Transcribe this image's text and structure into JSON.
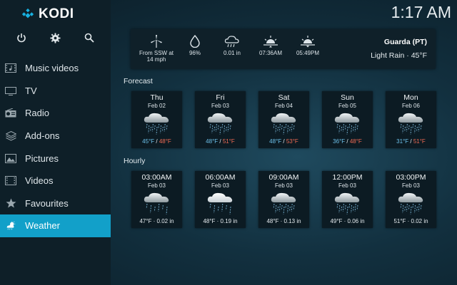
{
  "app": {
    "name": "KODI",
    "clock": "1:17 AM"
  },
  "sidebar": {
    "top_icons": [
      "power-icon",
      "settings-icon",
      "search-icon"
    ],
    "items": [
      {
        "label": "Music videos",
        "icon": "music-video-icon"
      },
      {
        "label": "TV",
        "icon": "tv-icon"
      },
      {
        "label": "Radio",
        "icon": "radio-icon"
      },
      {
        "label": "Add-ons",
        "icon": "addons-icon"
      },
      {
        "label": "Pictures",
        "icon": "pictures-icon"
      },
      {
        "label": "Videos",
        "icon": "videos-icon"
      },
      {
        "label": "Favourites",
        "icon": "star-icon"
      },
      {
        "label": "Weather",
        "icon": "weather-icon",
        "active": true
      }
    ]
  },
  "current": {
    "wind_line1": "From SSW at",
    "wind_line2": "14 mph",
    "humidity": "96%",
    "precip": "0.01 in",
    "sunrise": "07:36AM",
    "sunset": "05:49PM",
    "location": "Guarda (PT)",
    "condition": "Light Rain · 45°F"
  },
  "forecast": {
    "label": "Forecast",
    "days": [
      {
        "day": "Thu",
        "date": "Feb 02",
        "low": "45°F",
        "high": "48°F",
        "icon": "rain-cloud-icon"
      },
      {
        "day": "Fri",
        "date": "Feb 03",
        "low": "48°F",
        "high": "51°F",
        "icon": "rain-cloud-icon"
      },
      {
        "day": "Sat",
        "date": "Feb 04",
        "low": "48°F",
        "high": "53°F",
        "icon": "rain-cloud-icon"
      },
      {
        "day": "Sun",
        "date": "Feb 05",
        "low": "36°F",
        "high": "48°F",
        "icon": "rain-cloud-icon"
      },
      {
        "day": "Mon",
        "date": "Feb 06",
        "low": "31°F",
        "high": "51°F",
        "icon": "rain-cloud-icon"
      }
    ]
  },
  "hourly": {
    "label": "Hourly",
    "hours": [
      {
        "time": "03:00AM",
        "date": "Feb 03",
        "info": "47°F · 0.02 in",
        "icon": "light-rain-cloud-icon"
      },
      {
        "time": "06:00AM",
        "date": "Feb 03",
        "info": "48°F · 0.19 in",
        "icon": "heavy-rain-cloud-icon"
      },
      {
        "time": "09:00AM",
        "date": "Feb 03",
        "info": "48°F · 0.13 in",
        "icon": "rain-cloud-icon"
      },
      {
        "time": "12:00PM",
        "date": "Feb 03",
        "info": "49°F · 0.06 in",
        "icon": "rain-cloud-icon"
      },
      {
        "time": "03:00PM",
        "date": "Feb 03",
        "info": "51°F · 0.02 in",
        "icon": "rain-cloud-icon"
      }
    ]
  }
}
